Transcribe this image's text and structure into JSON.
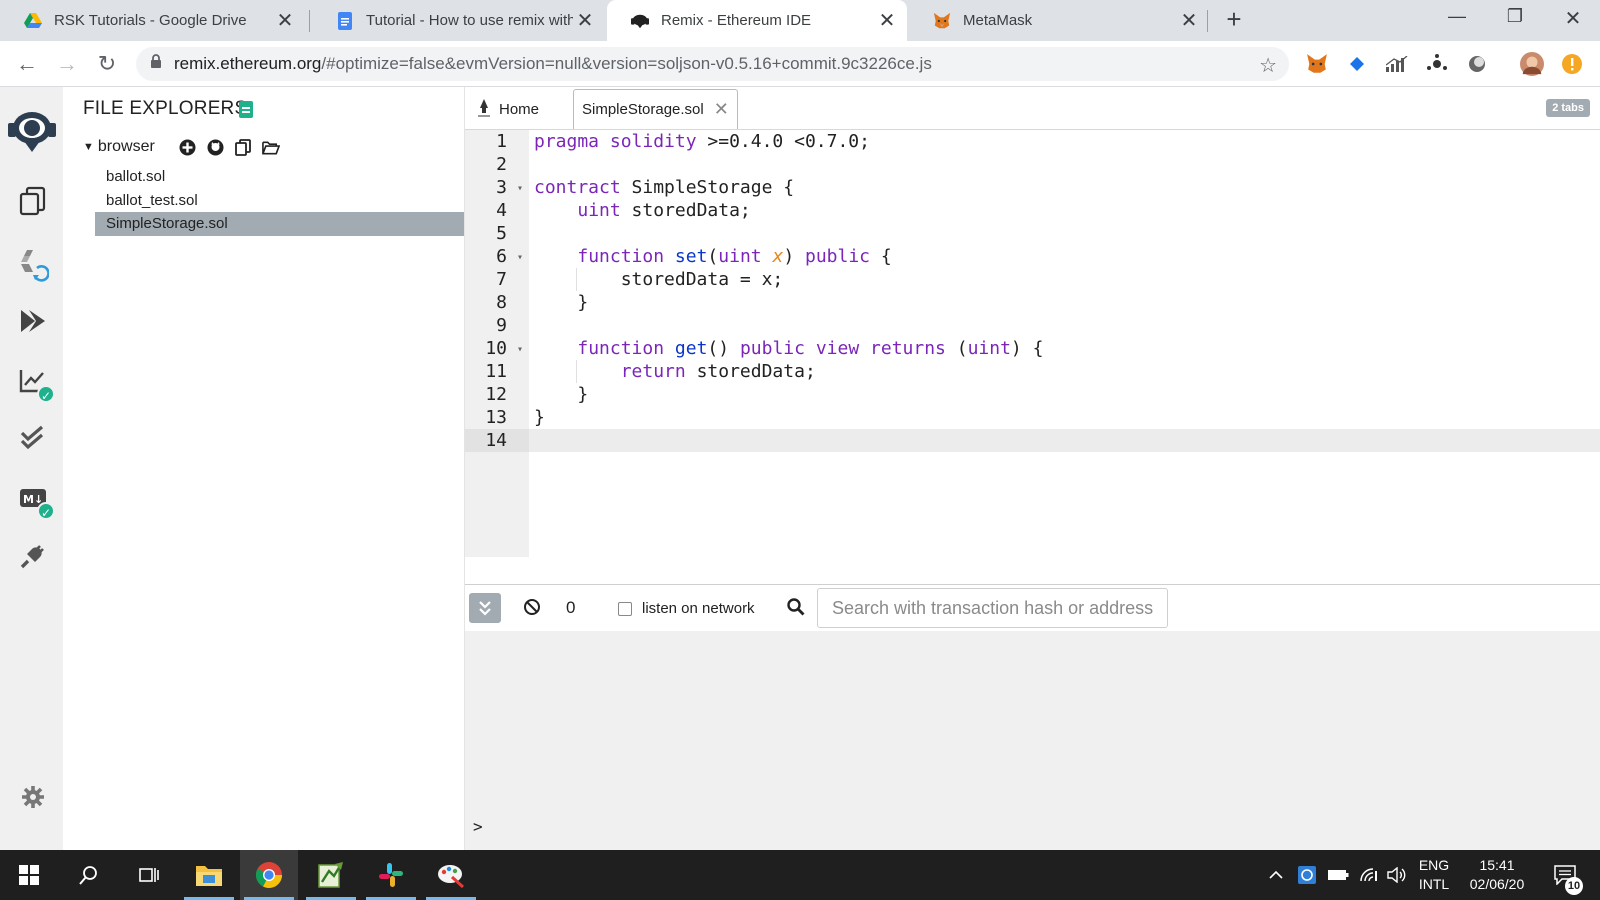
{
  "browser": {
    "tabs": [
      {
        "title": "RSK Tutorials - Google Drive",
        "icon": "google-drive-icon",
        "active": false
      },
      {
        "title": "Tutorial - How to use remix with",
        "icon": "google-docs-icon",
        "active": false
      },
      {
        "title": "Remix - Ethereum IDE",
        "icon": "remix-icon",
        "active": true
      },
      {
        "title": "MetaMask",
        "icon": "metamask-icon",
        "active": false
      }
    ],
    "new_tab": "+",
    "url_host": "remix.ethereum.org",
    "url_rest": "/#optimize=false&evmVersion=null&version=soljson-v0.5.16+commit.9c3226ce.js"
  },
  "explorer": {
    "title": "FILE EXPLORERS",
    "workspace": "browser",
    "files": [
      {
        "name": "ballot.sol",
        "selected": false
      },
      {
        "name": "ballot_test.sol",
        "selected": false
      },
      {
        "name": "SimpleStorage.sol",
        "selected": true
      }
    ]
  },
  "editor": {
    "home_tab": "Home",
    "file_tab": "SimpleStorage.sol",
    "tabs_badge": "2 tabs",
    "line_numbers": [
      "1",
      "2",
      "3",
      "4",
      "5",
      "6",
      "7",
      "8",
      "9",
      "10",
      "11",
      "12",
      "13",
      "14"
    ],
    "active_line": "14",
    "code": [
      "pragma solidity >=0.4.0 <0.7.0;",
      "",
      "contract SimpleStorage {",
      "    uint storedData;",
      "",
      "    function set(uint x) public {",
      "        storedData = x;",
      "    }",
      "",
      "    function get() public view returns (uint) {",
      "        return storedData;",
      "    }",
      "}",
      ""
    ]
  },
  "terminal": {
    "pending_count": "0",
    "listen_label": "listen on network",
    "search_placeholder": "Search with transaction hash or address",
    "prompt": ">"
  },
  "taskbar": {
    "lang_top": "ENG",
    "lang_bottom": "INTL",
    "time": "15:41",
    "date": "02/06/20",
    "notifications": "10"
  },
  "colors": {
    "accent": "#1fb08c",
    "keyword": "#7b26b8",
    "function": "#0b37c9",
    "param": "#e8871e",
    "selected_file": "#a2abb2"
  }
}
